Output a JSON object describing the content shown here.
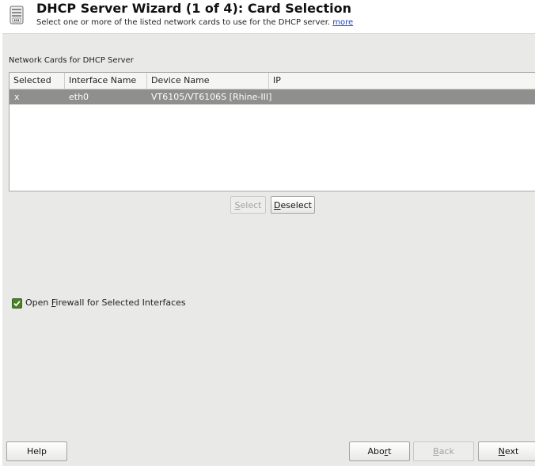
{
  "header": {
    "title": "DHCP Server Wizard (1 of 4): Card Selection",
    "subtitle": "Select one or more of the listed network cards to use for the DHCP server.",
    "more_link": "more",
    "icon": "server-config-icon"
  },
  "network_cards": {
    "label": "Network Cards for DHCP Server",
    "columns": {
      "selected": "Selected",
      "interface": "Interface Name",
      "device": "Device Name",
      "ip": "IP"
    },
    "rows": [
      {
        "selected": "x",
        "interface": "eth0",
        "device": "VT6105/VT6106S [Rhine-III]",
        "ip": ""
      }
    ]
  },
  "actions": {
    "select_label": "Select",
    "deselect_label": "Deselect"
  },
  "firewall": {
    "label": "Open Firewall for Selected Interfaces",
    "checked": true
  },
  "footer": {
    "help_label": "Help",
    "abort_label": "Abort",
    "back_label": "Back",
    "next_label": "Next"
  },
  "colors": {
    "selected_row": "#8f8f8d",
    "checkbox": "#4c7f27",
    "link": "#1c3fbf"
  }
}
